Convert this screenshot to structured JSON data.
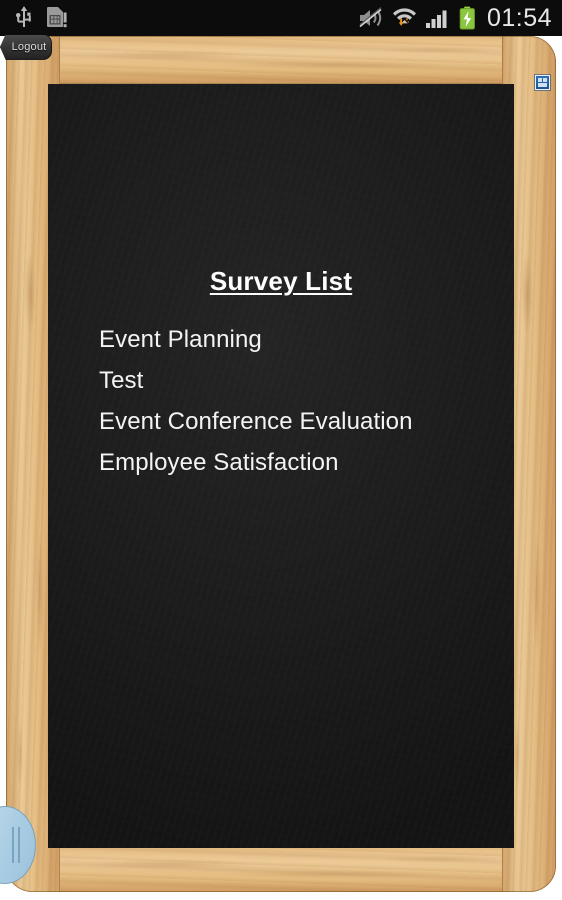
{
  "statusbar": {
    "clock": "01:54",
    "left_icons": [
      {
        "name": "usb-icon",
        "label": "USB connected"
      },
      {
        "name": "sim-card-alert-icon",
        "label": "SIM card alert"
      }
    ],
    "right_icons": [
      {
        "name": "volume-mute-icon",
        "label": "Sound muted"
      },
      {
        "name": "wifi-transfer-icon",
        "label": "Wi-Fi with data transfer"
      },
      {
        "name": "signal-bars-icon",
        "label": "Mobile signal"
      },
      {
        "name": "battery-charging-icon",
        "label": "Battery charging"
      }
    ],
    "background": "#0c0c0c",
    "text_color": "#e8e8e8",
    "battery_color": "#8cc63f"
  },
  "logout": {
    "label": "Logout"
  },
  "badge": {
    "name": "app-badge-icon",
    "color": "#1d5490"
  },
  "drag_handle": {
    "name": "edge-drag-handle",
    "color": "#a9cde3"
  },
  "board": {
    "background": "#1c1c1c",
    "text_color": "#f4f4f4",
    "title": "Survey List",
    "items": [
      {
        "label": "Event Planning"
      },
      {
        "label": "Test"
      },
      {
        "label": "Event Conference Evaluation"
      },
      {
        "label": "Employee Satisfaction"
      }
    ]
  },
  "frame": {
    "wood_color": "#e6be84",
    "wood_dark": "#c08a4d"
  }
}
